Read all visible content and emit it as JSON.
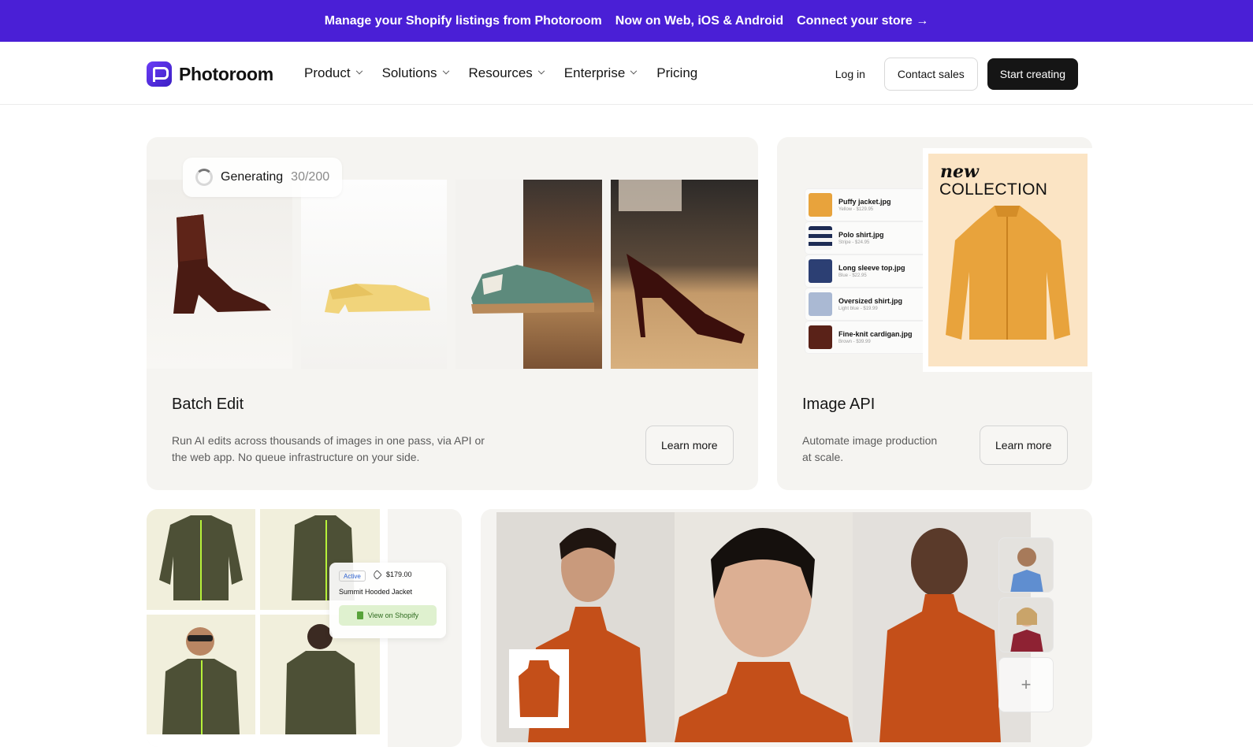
{
  "announcement": {
    "part1": "Manage your Shopify listings from Photoroom",
    "part2": "Now on Web, iOS & Android",
    "part3": "Connect your store →"
  },
  "nav": {
    "logo_text": "Photoroom",
    "menu": [
      {
        "label": "Product"
      },
      {
        "label": "Solutions"
      },
      {
        "label": "Resources"
      },
      {
        "label": "Enterprise"
      },
      {
        "label": "Pricing"
      }
    ],
    "login": "Log in",
    "contact_sales": "Contact sales",
    "start_creating": "Start creating"
  },
  "cards": {
    "batch_edit": {
      "generating_label": "Generating",
      "generating_count": "30/200",
      "title": "Batch Edit",
      "desc_line1": "Run AI edits across thousands of images in one pass, via API or",
      "desc_line2": "the web app. No queue infrastructure on your side.",
      "cta": "Learn more"
    },
    "image_api": {
      "title": "Image API",
      "desc_line1": "Automate image production",
      "desc_line2": "at scale.",
      "cta": "Learn more",
      "poster_new": "new",
      "poster_collection": "COLLECTION",
      "files": [
        {
          "name": "Puffy jacket.jpg",
          "sub": "Yellow - $129.95"
        },
        {
          "name": "Polo shirt.jpg",
          "sub": "Stripe - $24.95"
        },
        {
          "name": "Long sleeve top.jpg",
          "sub": "Blue - $22.95"
        },
        {
          "name": "Oversized shirt.jpg",
          "sub": "Light blue - $19.99"
        },
        {
          "name": "Fine-knit cardigan.jpg",
          "sub": "Brown - $39.99"
        }
      ]
    },
    "shopify": {
      "badge": "Active",
      "price": "$179.00",
      "product_name": "Summit Hooded Jacket",
      "button": "View on Shopify"
    },
    "models": {
      "add_symbol": "+"
    }
  },
  "colors": {
    "announcement_bg": "#4a1fd6",
    "card_bg": "#f5f4f1",
    "dark_button": "#151515",
    "accent_orange": "#c44f19"
  }
}
